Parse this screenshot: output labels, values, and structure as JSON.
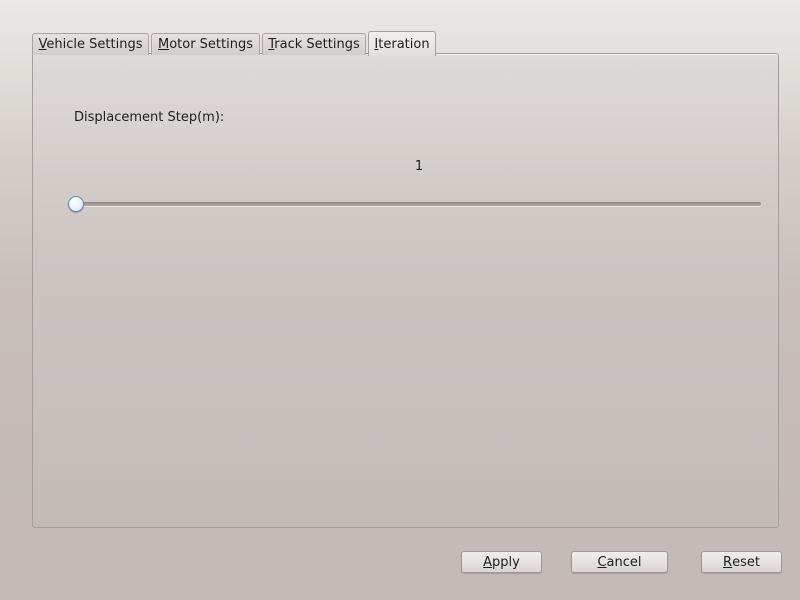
{
  "tabs": [
    {
      "mnemonic": "V",
      "rest": "ehicle Settings"
    },
    {
      "mnemonic": "M",
      "rest": "otor Settings"
    },
    {
      "mnemonic": "T",
      "rest": "rack Settings"
    },
    {
      "mnemonic": "I",
      "rest": "teration"
    }
  ],
  "active_tab_index": 3,
  "iteration": {
    "displacement_label": "Displacement Step(m):",
    "slider_value": "1",
    "slider_fraction": 0
  },
  "buttons": {
    "apply": {
      "mnemonic": "A",
      "rest": "pply"
    },
    "cancel": {
      "mnemonic": "C",
      "rest": "ancel"
    },
    "reset": {
      "mnemonic": "R",
      "rest": "eset"
    }
  },
  "colors": {
    "accent": "#6fa0c8"
  }
}
